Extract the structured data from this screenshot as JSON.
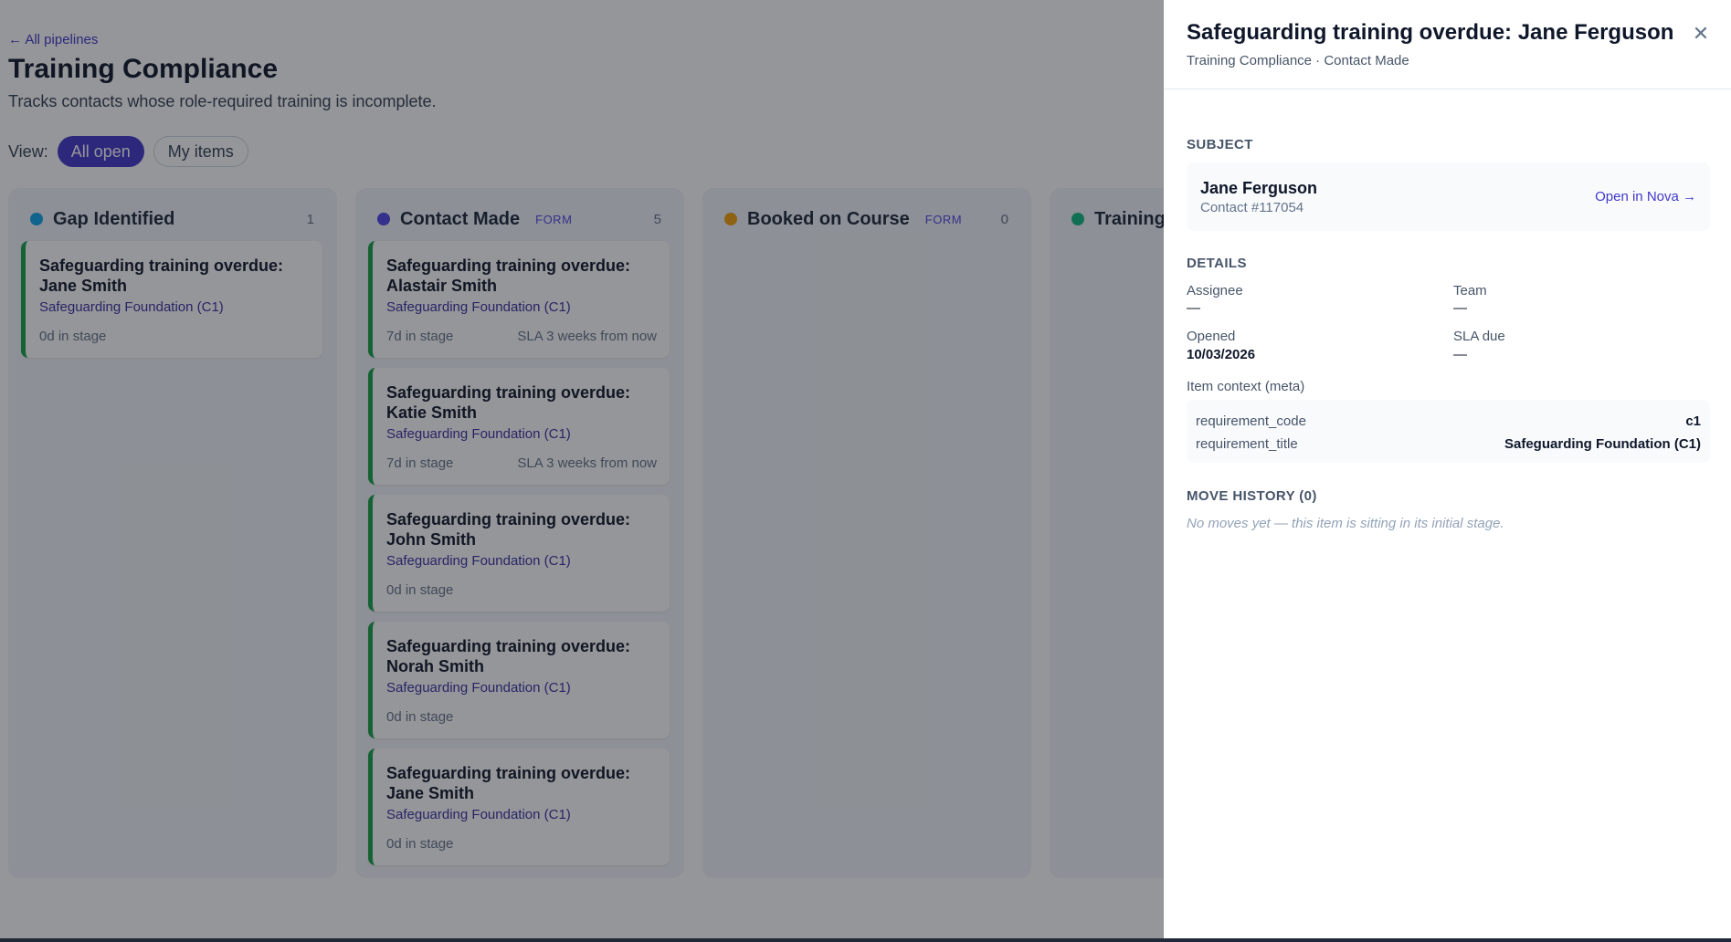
{
  "board": {
    "back_link": "← All pipelines",
    "title": "Training Compliance",
    "description": "Tracks contacts whose role-required training is incomplete.",
    "view_label": "View:",
    "views": [
      {
        "label": "All open",
        "active": true
      },
      {
        "label": "My items",
        "active": false
      }
    ],
    "columns": [
      {
        "name": "Gap Identified",
        "badge": "",
        "count": "1",
        "dot_color": "#0ea5e9",
        "cards": [
          {
            "title": "Safeguarding training overdue: Jane Smith",
            "requirement": "Safeguarding Foundation (C1)",
            "days": "0d in stage",
            "sla": ""
          }
        ]
      },
      {
        "name": "Contact Made",
        "badge": "FORM",
        "count": "5",
        "dot_color": "#4f46e5",
        "cards": [
          {
            "title": "Safeguarding training overdue: Alastair Smith",
            "requirement": "Safeguarding Foundation (C1)",
            "days": "7d in stage",
            "sla": "SLA 3 weeks from now"
          },
          {
            "title": "Safeguarding training overdue: Katie Smith",
            "requirement": "Safeguarding Foundation (C1)",
            "days": "7d in stage",
            "sla": "SLA 3 weeks from now"
          },
          {
            "title": "Safeguarding training overdue: John Smith",
            "requirement": "Safeguarding Foundation (C1)",
            "days": "0d in stage",
            "sla": ""
          },
          {
            "title": "Safeguarding training overdue: Norah Smith",
            "requirement": "Safeguarding Foundation (C1)",
            "days": "0d in stage",
            "sla": ""
          },
          {
            "title": "Safeguarding training overdue: Jane Smith",
            "requirement": "Safeguarding Foundation (C1)",
            "days": "0d in stage",
            "sla": ""
          }
        ]
      },
      {
        "name": "Booked on Course",
        "badge": "FORM",
        "count": "0",
        "dot_color": "#f59e0b",
        "cards": []
      },
      {
        "name": "Training",
        "badge": "",
        "count": "",
        "dot_color": "#10b981",
        "cards": []
      }
    ]
  },
  "panel": {
    "title": "Safeguarding training overdue: Jane Ferguson",
    "subtitle": "Training Compliance · Contact Made",
    "close_icon": "close-icon",
    "subject_heading": "SUBJECT",
    "subject_name": "Jane Ferguson",
    "subject_id": "Contact #117054",
    "subject_link": "Open in Nova →",
    "details_heading": "DETAILS",
    "assignee_label": "Assignee",
    "assignee_value": "—",
    "team_label": "Team",
    "team_value": "—",
    "opened_label": "Opened",
    "opened_value": "10/03/2026",
    "sla_label": "SLA due",
    "sla_value": "—",
    "meta_label": "Item context (meta)",
    "meta_rows": [
      {
        "key": "requirement_code",
        "value": "c1"
      },
      {
        "key": "requirement_title",
        "value": "Safeguarding Foundation (C1)"
      }
    ],
    "history_heading": "MOVE HISTORY (0)",
    "history_empty": "No moves yet — this item is sitting in its initial stage."
  },
  "colors": {
    "accent": "#4338ca",
    "card_border": "#16a34a",
    "overlay": "rgba(20,23,28,0.45)"
  }
}
